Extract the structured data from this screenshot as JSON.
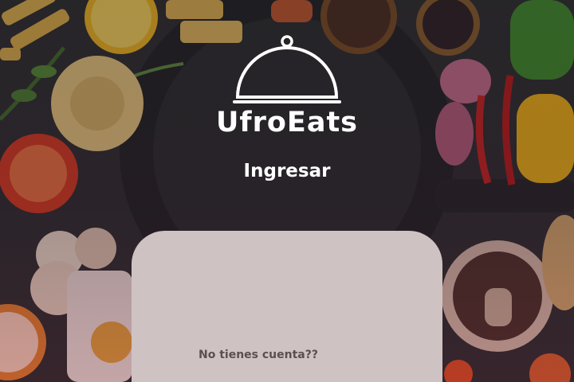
{
  "app": {
    "title": "UfroEats",
    "logo_icon": "cloche-icon"
  },
  "login": {
    "heading": "Ingresar",
    "signup_prompt": "No tienes cuenta??"
  },
  "colors": {
    "card_background": "#cfc2c2",
    "title_text": "#ffffff",
    "prompt_text": "#5a5050"
  }
}
